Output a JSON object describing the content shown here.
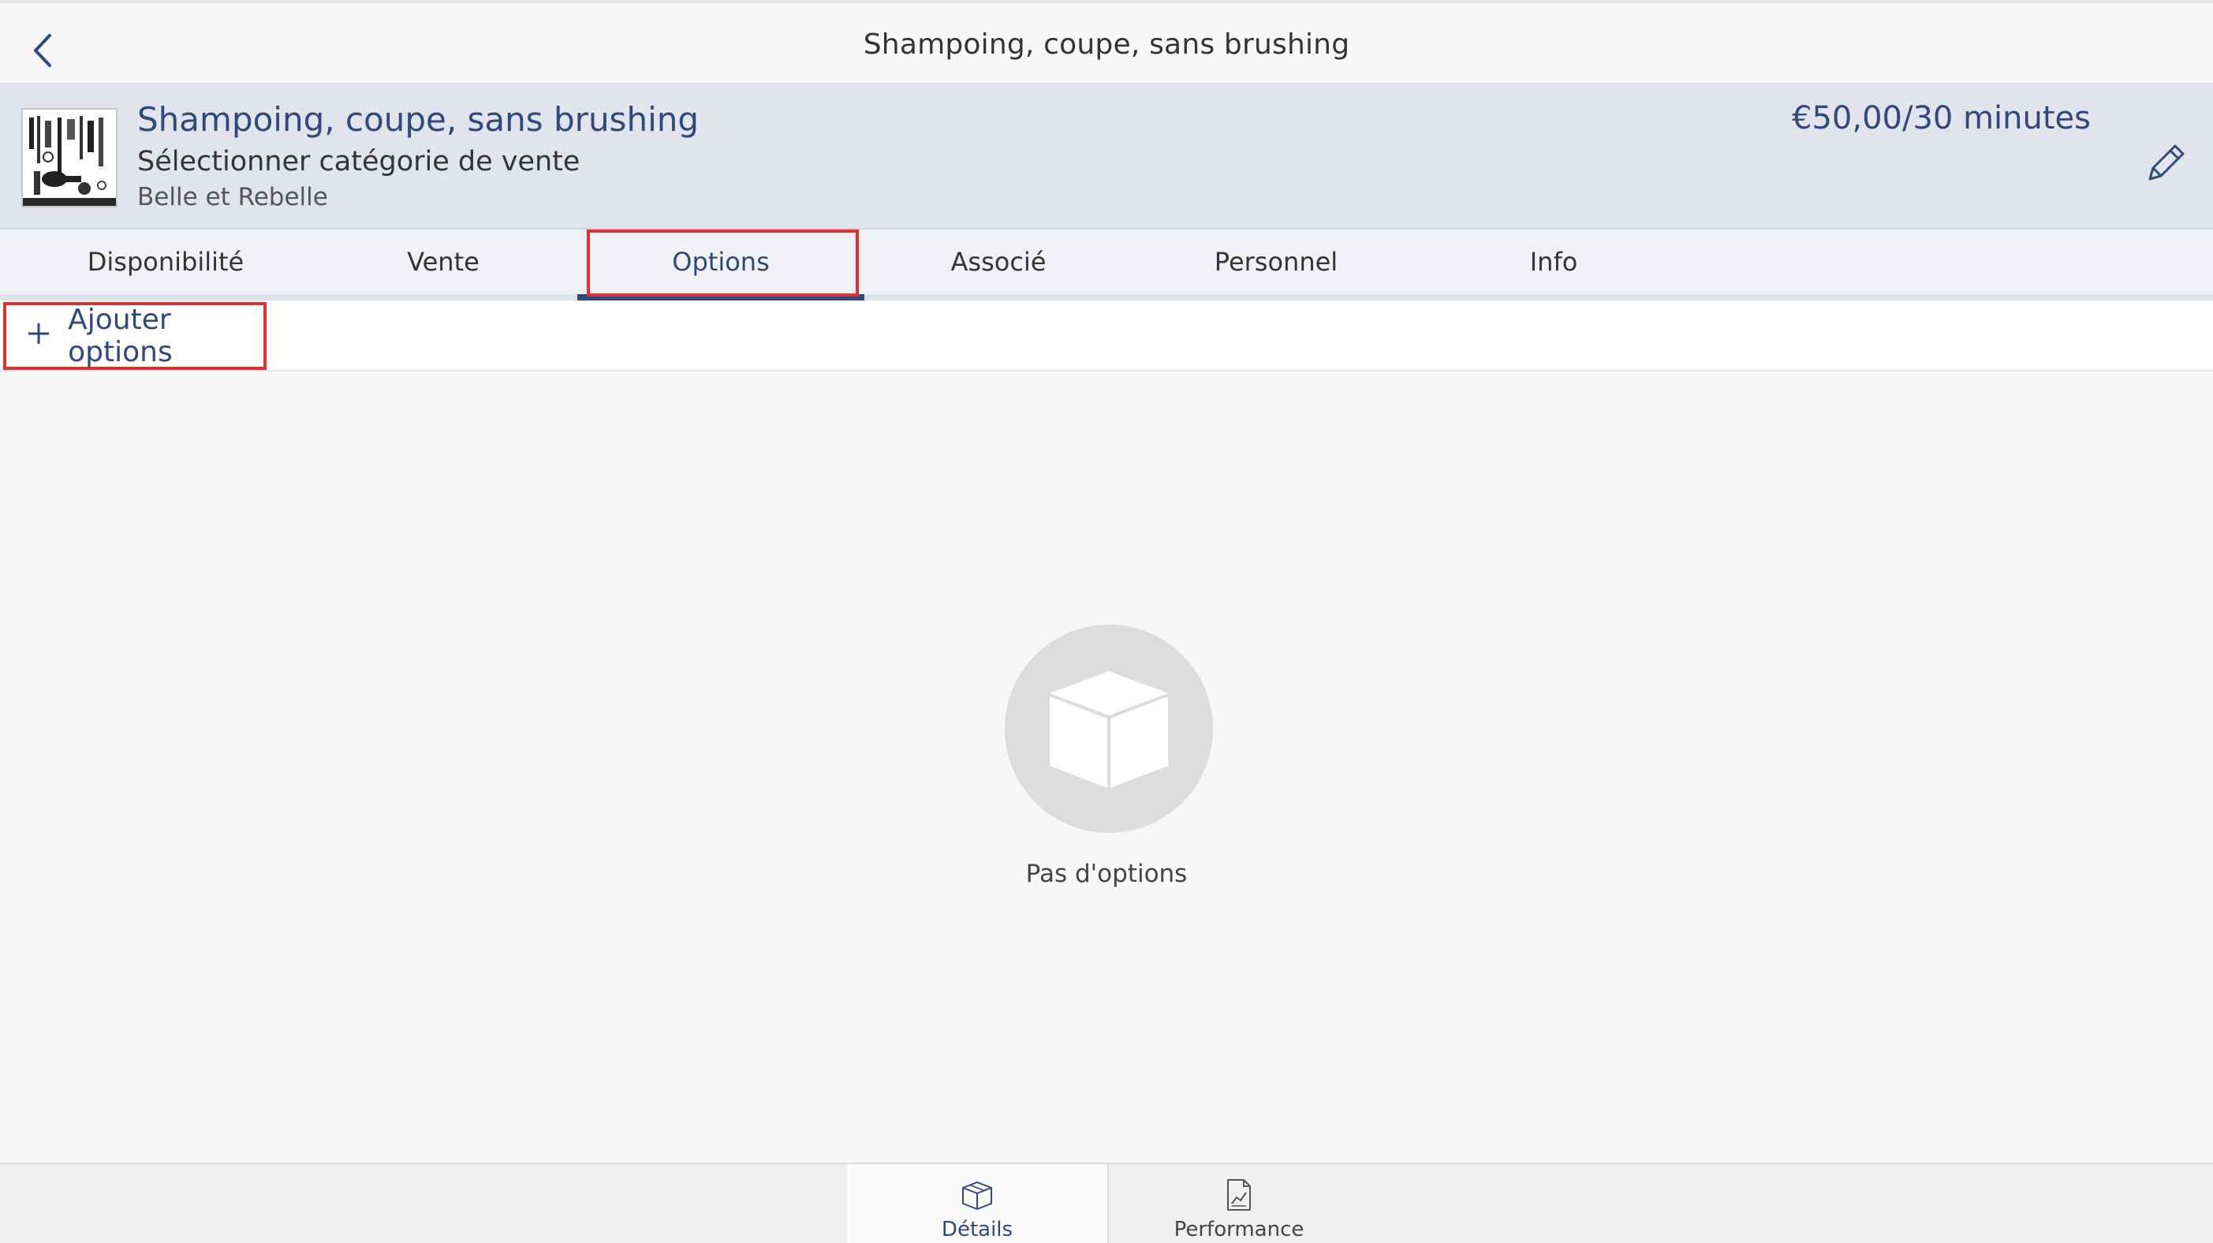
{
  "navbar": {
    "title": "Shampoing, coupe, sans brushing"
  },
  "header": {
    "service_name": "Shampoing, coupe, sans brushing",
    "category": "Sélectionner catégorie de vente",
    "shop": "Belle et Rebelle",
    "price": "€50,00/30 minutes"
  },
  "tabs": [
    {
      "label": "Disponibilité",
      "active": false
    },
    {
      "label": "Vente",
      "active": false
    },
    {
      "label": "Options",
      "active": true
    },
    {
      "label": "Associé",
      "active": false
    },
    {
      "label": "Personnel",
      "active": false
    },
    {
      "label": "Info",
      "active": false
    }
  ],
  "add_options": {
    "icon": "plus-icon",
    "label": "Ajouter options"
  },
  "empty_state": {
    "icon": "box-icon",
    "text": "Pas d'options"
  },
  "bottom_tabs": [
    {
      "label": "Détails",
      "icon": "box-icon",
      "active": true
    },
    {
      "label": "Performance",
      "icon": "chart-document-icon",
      "active": false
    }
  ],
  "colors": {
    "accent": "#2f4a7a",
    "highlight": "#e03030",
    "header_bg": "#e1e4ec"
  }
}
